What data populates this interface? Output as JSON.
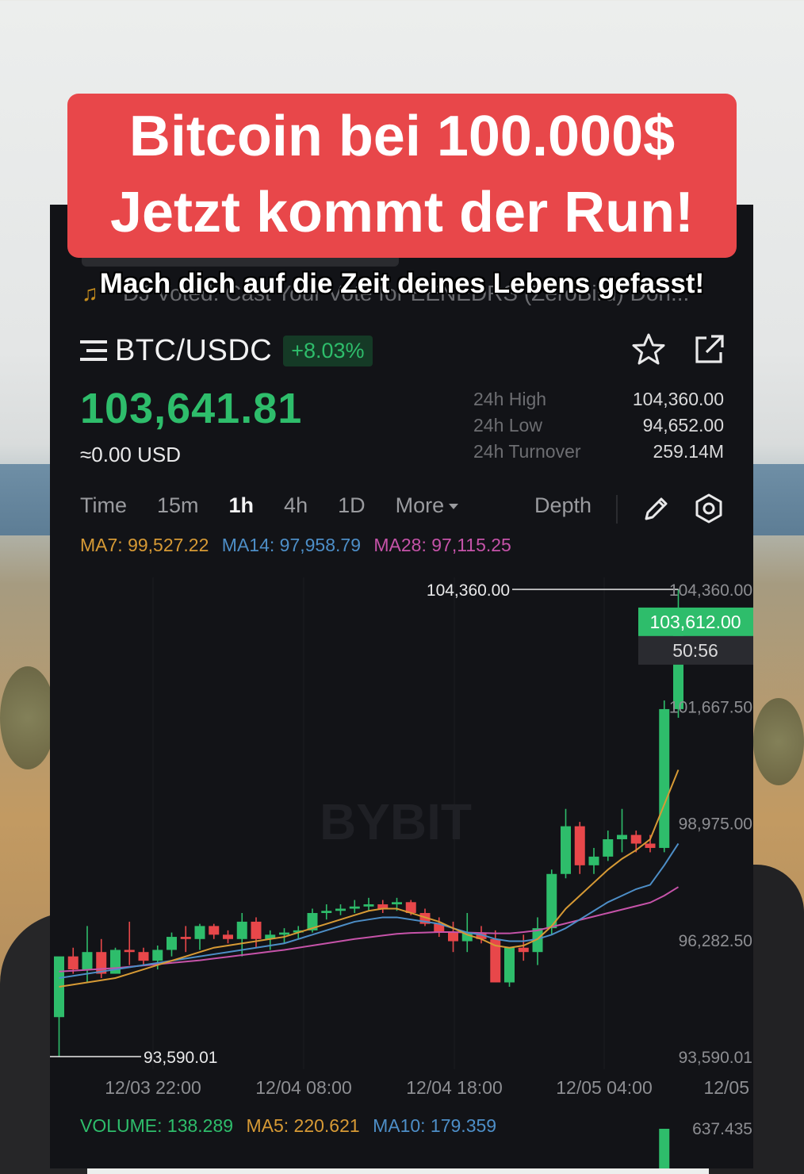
{
  "overlay": {
    "title_line1": "Bitcoin bei 100.000$",
    "title_line2": "Jetzt kommt der Run!",
    "subtitle": "Mach dich auf die Zeit deines Lebens gefasst!"
  },
  "ticker": {
    "text": "DJ Voted: Cast Your Vote for EENEDRS (ZeroBird) Don..."
  },
  "market": {
    "pair": "BTC/USDC",
    "change": "+8.03%",
    "price": "103,641.81",
    "fiat": "≈0.00 USD",
    "stats": [
      {
        "label": "24h High",
        "value": "104,360.00"
      },
      {
        "label": "24h Low",
        "value": "94,652.00"
      },
      {
        "label": "24h Turnover",
        "value": "259.14M"
      }
    ]
  },
  "tabs": [
    {
      "label": "Time",
      "active": false
    },
    {
      "label": "15m",
      "active": false
    },
    {
      "label": "1h",
      "active": true
    },
    {
      "label": "4h",
      "active": false
    },
    {
      "label": "1D",
      "active": false
    },
    {
      "label": "More",
      "active": false
    }
  ],
  "depth_label": "Depth",
  "indicators": {
    "ma7": "MA7: 99,527.22",
    "ma14": "MA14: 97,958.79",
    "ma28": "MA28: 97,115.25"
  },
  "volume_indicators": {
    "volume": "VOLUME: 138.289",
    "ma5": "MA5: 220.621",
    "ma10": "MA10: 179.359",
    "axis_value": "637.435"
  },
  "colors": {
    "up": "#2ebd6b",
    "down": "#e8474a",
    "ma7": "#d79a35",
    "ma14": "#4d8ec7",
    "ma28": "#c653a9",
    "title_bg": "#e8474a"
  },
  "icons": [
    "menu-icon",
    "star-icon",
    "share-icon",
    "pencil-icon",
    "settings-icon"
  ],
  "chart_data": {
    "type": "candlestick",
    "watermark": "BYBIT",
    "ylim": [
      93590.01,
      104360.0
    ],
    "y_tick_labels": [
      "104,360.00",
      "101,667.50",
      "98,975.00",
      "96,282.50",
      "93,590.01"
    ],
    "x_tick_labels": [
      "12/03 22:00",
      "12/04 08:00",
      "12/04 18:00",
      "12/05 04:00",
      "12/05"
    ],
    "high_label": "104,360.00",
    "low_label": "93,590.01",
    "current_price_label": "103,612.00",
    "countdown_label": "50:56",
    "candles": [
      {
        "o": 94500,
        "h": 95800,
        "l": 93590,
        "c": 95900
      },
      {
        "o": 95900,
        "h": 96100,
        "l": 95500,
        "c": 95600
      },
      {
        "o": 95600,
        "h": 96600,
        "l": 95300,
        "c": 96000
      },
      {
        "o": 96000,
        "h": 96300,
        "l": 95400,
        "c": 95500
      },
      {
        "o": 95500,
        "h": 96100,
        "l": 95500,
        "c": 96050
      },
      {
        "o": 96050,
        "h": 96700,
        "l": 95700,
        "c": 96000
      },
      {
        "o": 96000,
        "h": 96100,
        "l": 95700,
        "c": 95800
      },
      {
        "o": 95800,
        "h": 96150,
        "l": 95600,
        "c": 96050
      },
      {
        "o": 96050,
        "h": 96450,
        "l": 95900,
        "c": 96350
      },
      {
        "o": 96350,
        "h": 96600,
        "l": 96000,
        "c": 96300
      },
      {
        "o": 96300,
        "h": 96650,
        "l": 96050,
        "c": 96600
      },
      {
        "o": 96600,
        "h": 96650,
        "l": 96300,
        "c": 96400
      },
      {
        "o": 96400,
        "h": 96500,
        "l": 96200,
        "c": 96300
      },
      {
        "o": 96300,
        "h": 96900,
        "l": 95900,
        "c": 96700
      },
      {
        "o": 96700,
        "h": 96800,
        "l": 96100,
        "c": 96300
      },
      {
        "o": 96300,
        "h": 96500,
        "l": 96050,
        "c": 96400
      },
      {
        "o": 96400,
        "h": 96550,
        "l": 96200,
        "c": 96450
      },
      {
        "o": 96450,
        "h": 96600,
        "l": 96300,
        "c": 96500
      },
      {
        "o": 96500,
        "h": 97000,
        "l": 96450,
        "c": 96900
      },
      {
        "o": 96900,
        "h": 97100,
        "l": 96750,
        "c": 96950
      },
      {
        "o": 96950,
        "h": 97100,
        "l": 96850,
        "c": 97000
      },
      {
        "o": 97000,
        "h": 97200,
        "l": 96900,
        "c": 97050
      },
      {
        "o": 97050,
        "h": 97250,
        "l": 96950,
        "c": 97100
      },
      {
        "o": 97100,
        "h": 97200,
        "l": 96900,
        "c": 97000
      },
      {
        "o": 97100,
        "h": 97250,
        "l": 96950,
        "c": 97150
      },
      {
        "o": 97150,
        "h": 97200,
        "l": 96850,
        "c": 96900
      },
      {
        "o": 96900,
        "h": 97000,
        "l": 96600,
        "c": 96650
      },
      {
        "o": 96650,
        "h": 96800,
        "l": 96350,
        "c": 96450
      },
      {
        "o": 96450,
        "h": 96700,
        "l": 96000,
        "c": 96250
      },
      {
        "o": 96250,
        "h": 96900,
        "l": 96000,
        "c": 96450
      },
      {
        "o": 96450,
        "h": 96600,
        "l": 96200,
        "c": 96300
      },
      {
        "o": 96300,
        "h": 96500,
        "l": 95300,
        "c": 95300
      },
      {
        "o": 95300,
        "h": 96100,
        "l": 95200,
        "c": 96100
      },
      {
        "o": 96100,
        "h": 96400,
        "l": 95800,
        "c": 96000
      },
      {
        "o": 96000,
        "h": 96800,
        "l": 95700,
        "c": 96550
      },
      {
        "o": 96550,
        "h": 97900,
        "l": 96400,
        "c": 97800
      },
      {
        "o": 97800,
        "h": 99300,
        "l": 97700,
        "c": 98900
      },
      {
        "o": 98900,
        "h": 99000,
        "l": 97800,
        "c": 98000
      },
      {
        "o": 98000,
        "h": 98400,
        "l": 97800,
        "c": 98200
      },
      {
        "o": 98200,
        "h": 98800,
        "l": 98100,
        "c": 98600
      },
      {
        "o": 98600,
        "h": 99300,
        "l": 98300,
        "c": 98700
      },
      {
        "o": 98700,
        "h": 98800,
        "l": 98300,
        "c": 98500
      },
      {
        "o": 98500,
        "h": 98700,
        "l": 98300,
        "c": 98400
      },
      {
        "o": 98400,
        "h": 101800,
        "l": 98300,
        "c": 101600
      },
      {
        "o": 101600,
        "h": 104360,
        "l": 101400,
        "c": 103612
      }
    ],
    "ma7": [
      95200,
      95250,
      95300,
      95350,
      95400,
      95500,
      95600,
      95700,
      95800,
      95900,
      96000,
      96100,
      96150,
      96200,
      96250,
      96300,
      96350,
      96450,
      96550,
      96650,
      96750,
      96850,
      96950,
      97000,
      97000,
      96900,
      96800,
      96700,
      96550,
      96400,
      96300,
      96150,
      96100,
      96150,
      96300,
      96600,
      97000,
      97300,
      97600,
      97900,
      98150,
      98350,
      98600,
      99400,
      100200
    ],
    "ma14": [
      95400,
      95450,
      95500,
      95550,
      95600,
      95650,
      95700,
      95750,
      95800,
      95850,
      95900,
      95950,
      96000,
      96050,
      96100,
      96150,
      96200,
      96300,
      96400,
      96500,
      96600,
      96700,
      96750,
      96800,
      96800,
      96750,
      96700,
      96650,
      96550,
      96450,
      96400,
      96300,
      96250,
      96250,
      96300,
      96400,
      96550,
      96750,
      96950,
      97150,
      97300,
      97450,
      97550,
      98000,
      98500
    ],
    "ma28": [
      95550,
      95570,
      95590,
      95610,
      95630,
      95660,
      95690,
      95720,
      95750,
      95780,
      95810,
      95850,
      95890,
      95930,
      95970,
      96010,
      96050,
      96100,
      96150,
      96200,
      96250,
      96300,
      96340,
      96380,
      96420,
      96440,
      96450,
      96460,
      96460,
      96450,
      96440,
      96430,
      96430,
      96460,
      96500,
      96580,
      96660,
      96740,
      96820,
      96900,
      96980,
      97060,
      97140,
      97300,
      97500
    ],
    "volume_first_bar_label": "637.435"
  }
}
